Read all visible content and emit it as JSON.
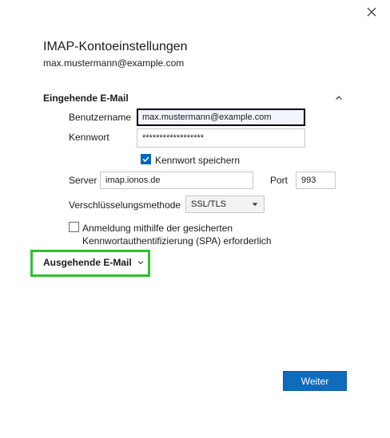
{
  "dialog": {
    "title": "IMAP-Kontoeinstellungen",
    "account_email": "max.mustermann@example.com"
  },
  "incoming": {
    "section_title": "Eingehende E-Mail",
    "username_label": "Benutzername",
    "username_value": "max.mustermann@example.com",
    "password_label": "Kennwort",
    "password_value": "******************",
    "save_password_label": "Kennwort speichern",
    "save_password_checked": true,
    "server_label": "Server",
    "server_value": "imap.ionos.de",
    "port_label": "Port",
    "port_value": "993",
    "encryption_label": "Verschlüsselungsmethode",
    "encryption_value": "SSL/TLS",
    "spa_label_line1": "Anmeldung mithilfe der gesicherten",
    "spa_label_line2": "Kennwortauthentifizierung (SPA) erforderlich",
    "spa_checked": false
  },
  "outgoing": {
    "section_title": "Ausgehende E-Mail"
  },
  "buttons": {
    "next_label": "Weiter"
  },
  "colors": {
    "accent": "#0f6cbd",
    "highlight": "#2ec22e"
  }
}
